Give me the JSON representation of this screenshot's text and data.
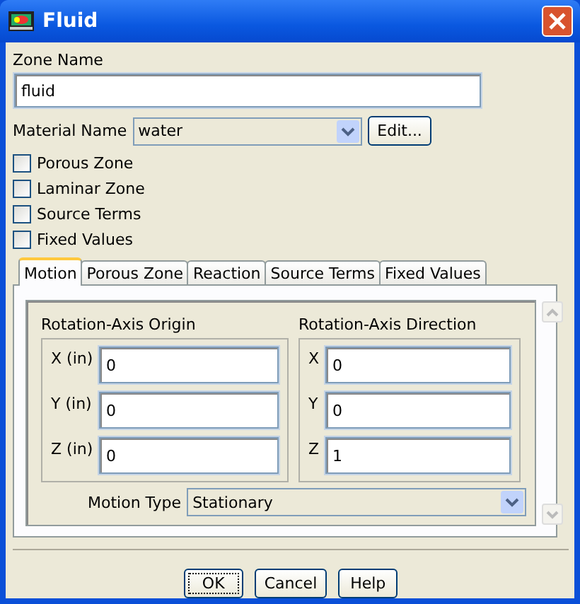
{
  "window": {
    "title": "Fluid"
  },
  "zone_name": {
    "label": "Zone Name",
    "value": "fluid"
  },
  "material_name": {
    "label": "Material Name",
    "value": "water",
    "edit_button": "Edit..."
  },
  "options": [
    {
      "label": "Porous Zone",
      "checked": false
    },
    {
      "label": "Laminar Zone",
      "checked": false
    },
    {
      "label": "Source Terms",
      "checked": false
    },
    {
      "label": "Fixed Values",
      "checked": false
    }
  ],
  "tabs": [
    {
      "label": "Motion",
      "selected": true
    },
    {
      "label": "Porous Zone",
      "selected": false
    },
    {
      "label": "Reaction",
      "selected": false
    },
    {
      "label": "Source Terms",
      "selected": false
    },
    {
      "label": "Fixed Values",
      "selected": false
    }
  ],
  "origin": {
    "title": "Rotation-Axis Origin",
    "fields": [
      {
        "label": "X (in)",
        "value": "0"
      },
      {
        "label": "Y (in)",
        "value": "0"
      },
      {
        "label": "Z (in)",
        "value": "0"
      }
    ]
  },
  "direction": {
    "title": "Rotation-Axis Direction",
    "fields": [
      {
        "label": "X",
        "value": "0"
      },
      {
        "label": "Y",
        "value": "0"
      },
      {
        "label": "Z",
        "value": "1"
      }
    ]
  },
  "motion_type": {
    "label": "Motion Type",
    "value": "Stationary"
  },
  "buttons": [
    "OK",
    "Cancel",
    "Help"
  ]
}
